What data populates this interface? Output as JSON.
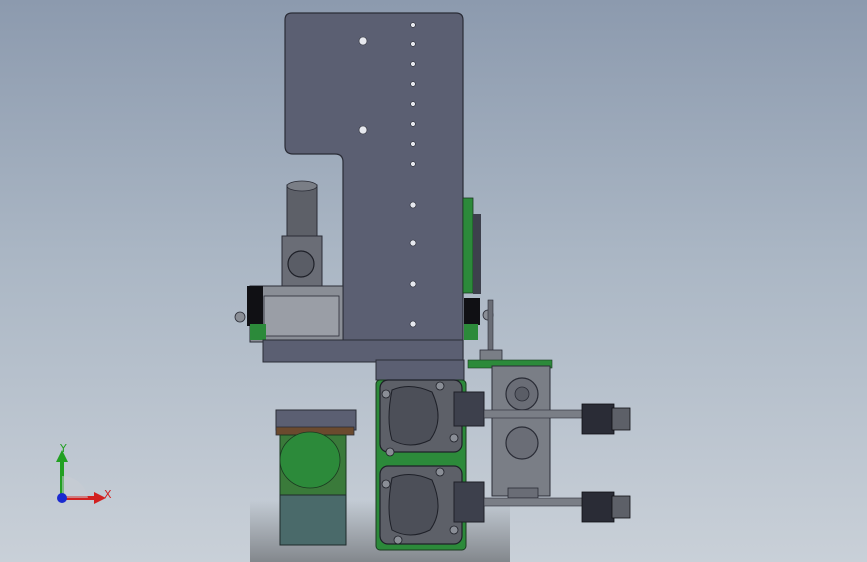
{
  "viewport": {
    "background_top": "#8c9aae",
    "background_bottom": "#c9d0d8",
    "model_colors": {
      "plate": "#5b5f72",
      "plate_edge": "#2a2c36",
      "dark": "#3d404c",
      "green": "#2c8a3a",
      "gray": "#8a8e96",
      "teal": "#4a6a6a",
      "brown": "#6b4a2e"
    }
  },
  "triad": {
    "x_label": "X",
    "y_label": "Y",
    "x_color": "#d22020",
    "y_color": "#22a022",
    "z_color": "#1a2ad0"
  }
}
